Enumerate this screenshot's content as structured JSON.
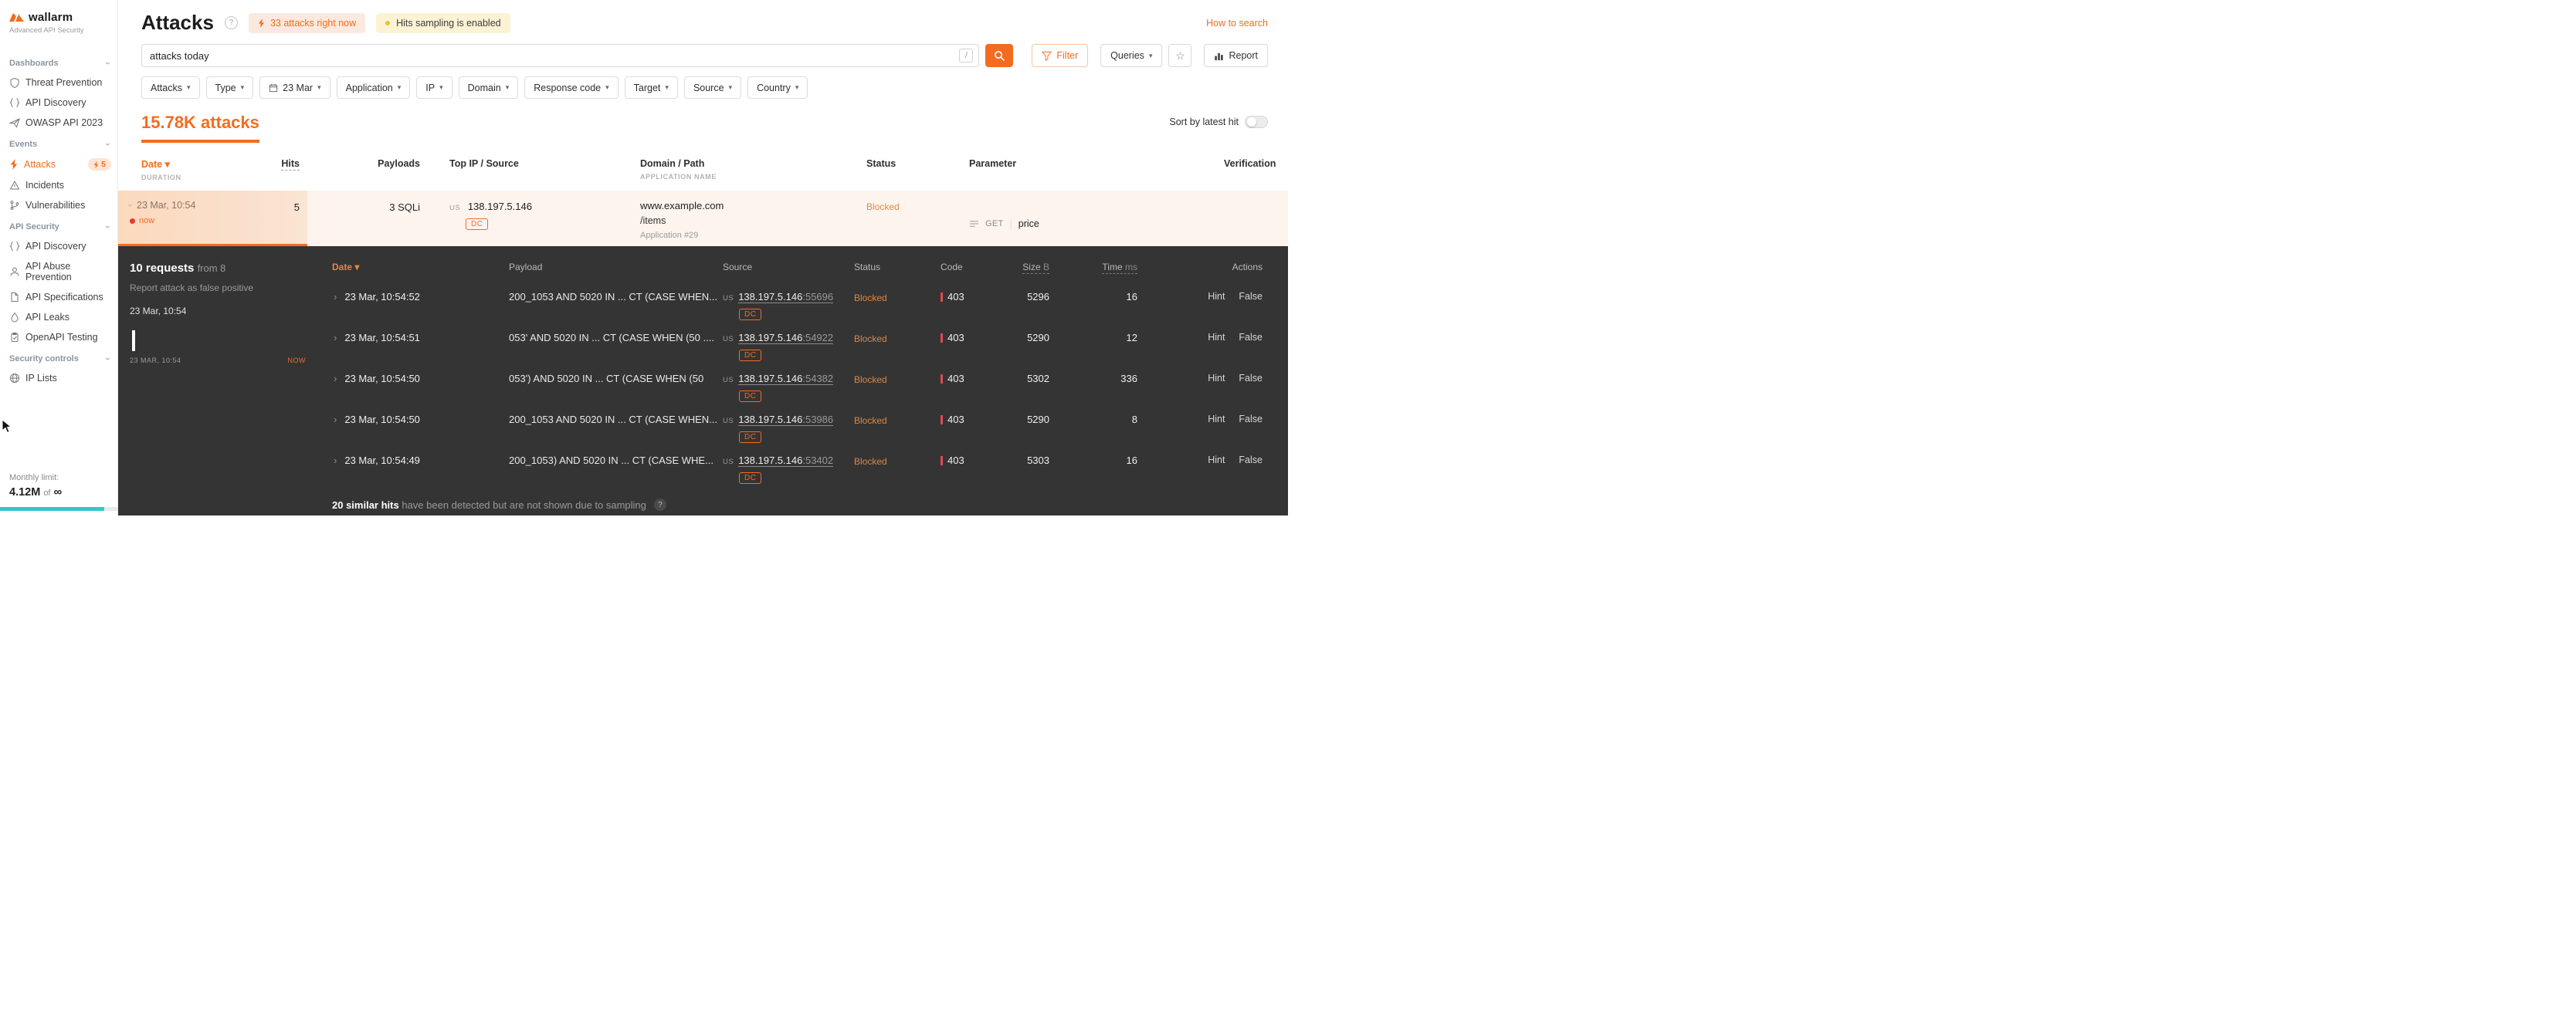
{
  "brand": {
    "name": "wallarm",
    "subtitle": "Advanced API Security"
  },
  "colors": {
    "accent": "#f36c21",
    "panel_bg": "#343434",
    "blocked": "#e08a44",
    "error_red": "#e5484d",
    "sampling_dot": "#e7c428",
    "limit_bar": "#38c6c6"
  },
  "sidebar": {
    "sections": [
      {
        "label": "Dashboards",
        "items": [
          {
            "label": "Threat Prevention"
          },
          {
            "label": "API Discovery"
          },
          {
            "label": "OWASP API 2023"
          }
        ]
      },
      {
        "label": "Events",
        "items": [
          {
            "label": "Attacks",
            "badge": "5"
          },
          {
            "label": "Incidents"
          },
          {
            "label": "Vulnerabilities"
          }
        ]
      },
      {
        "label": "API Security",
        "items": [
          {
            "label": "API Discovery"
          },
          {
            "label": "API Abuse Prevention"
          },
          {
            "label": "API Specifications"
          },
          {
            "label": "API Leaks"
          },
          {
            "label": "OpenAPI Testing"
          }
        ]
      },
      {
        "label": "Security controls",
        "items": [
          {
            "label": "IP Lists"
          }
        ]
      }
    ],
    "monthly_limit": {
      "label": "Monthly limit:",
      "value": "4.12M",
      "of_text": "of",
      "infinity": "∞"
    }
  },
  "header": {
    "title": "Attacks",
    "attacks_now_badge": "33 attacks right now",
    "sampling_badge": "Hits sampling is enabled",
    "how_to_search": "How to search"
  },
  "search": {
    "value": "attacks today",
    "shortcut": "/"
  },
  "toolbar": {
    "filter": "Filter",
    "queries": "Queries",
    "report": "Report"
  },
  "filters": [
    {
      "label": "Attacks"
    },
    {
      "label": "Type"
    },
    {
      "label": "23 Mar"
    },
    {
      "label": "Application"
    },
    {
      "label": "IP"
    },
    {
      "label": "Domain"
    },
    {
      "label": "Response code"
    },
    {
      "label": "Target"
    },
    {
      "label": "Source"
    },
    {
      "label": "Country"
    }
  ],
  "summary": {
    "count": "15.78K attacks",
    "sort_label": "Sort by latest hit"
  },
  "attacks_table": {
    "headers": {
      "date": "Date",
      "duration": "DURATION",
      "hits": "Hits",
      "payloads": "Payloads",
      "source": "Top IP / Source",
      "domain": "Domain / Path",
      "application_name": "APPLICATION NAME",
      "status": "Status",
      "parameter": "Parameter",
      "verification": "Verification"
    },
    "row": {
      "date": "23 Mar, 10:54",
      "now": "now",
      "hits": "5",
      "payloads": "3 SQLi",
      "country": "US",
      "ip": "138.197.5.146",
      "tag": "DC",
      "domain": "www.example.com",
      "path": "/items",
      "application": "Application #29",
      "status": "Blocked",
      "method": "GET",
      "parameter": "price"
    }
  },
  "details": {
    "requests_count": "10 requests",
    "requests_from": "from 8",
    "report_link": "Report attack as false positive",
    "time": "23 Mar, 10:54",
    "chart": {
      "start_label": "23 MAR, 10:54",
      "end_label": "NOW"
    },
    "headers": {
      "date": "Date",
      "payload": "Payload",
      "source": "Source",
      "status": "Status",
      "code": "Code",
      "size": "Size",
      "size_unit": "B",
      "time": "Time",
      "time_unit": "ms",
      "actions": "Actions"
    },
    "hits": [
      {
        "date": "23 Mar, 10:54:52",
        "payload": "200_1053 AND 5020 IN ... CT (CASE WHEN...",
        "country": "US",
        "ip": "138.197.5.146",
        "port": "55696",
        "tag": "DC",
        "status": "Blocked",
        "code": "403",
        "size": "5296",
        "time": "16",
        "hint": "Hint",
        "false_label": "False"
      },
      {
        "date": "23 Mar, 10:54:51",
        "payload": "053' AND 5020 IN ... CT (CASE WHEN (50 ....",
        "country": "US",
        "ip": "138.197.5.146",
        "port": "54922",
        "tag": "DC",
        "status": "Blocked",
        "code": "403",
        "size": "5290",
        "time": "12",
        "hint": "Hint",
        "false_label": "False"
      },
      {
        "date": "23 Mar, 10:54:50",
        "payload": "053') AND 5020 IN ... CT (CASE WHEN (50",
        "country": "US",
        "ip": "138.197.5.146",
        "port": "54382",
        "tag": "DC",
        "status": "Blocked",
        "code": "403",
        "size": "5302",
        "time": "336",
        "hint": "Hint",
        "false_label": "False"
      },
      {
        "date": "23 Mar, 10:54:50",
        "payload": "200_1053 AND 5020 IN ... CT (CASE WHEN...",
        "country": "US",
        "ip": "138.197.5.146",
        "port": "53986",
        "tag": "DC",
        "status": "Blocked",
        "code": "403",
        "size": "5290",
        "time": "8",
        "hint": "Hint",
        "false_label": "False"
      },
      {
        "date": "23 Mar, 10:54:49",
        "payload": "200_1053) AND 5020 IN ... CT (CASE WHE...",
        "country": "US",
        "ip": "138.197.5.146",
        "port": "53402",
        "tag": "DC",
        "status": "Blocked",
        "code": "403",
        "size": "5303",
        "time": "16",
        "hint": "Hint",
        "false_label": "False"
      }
    ],
    "footer": {
      "bold": "20 similar hits",
      "rest": " have been detected but are not shown due to sampling"
    }
  }
}
